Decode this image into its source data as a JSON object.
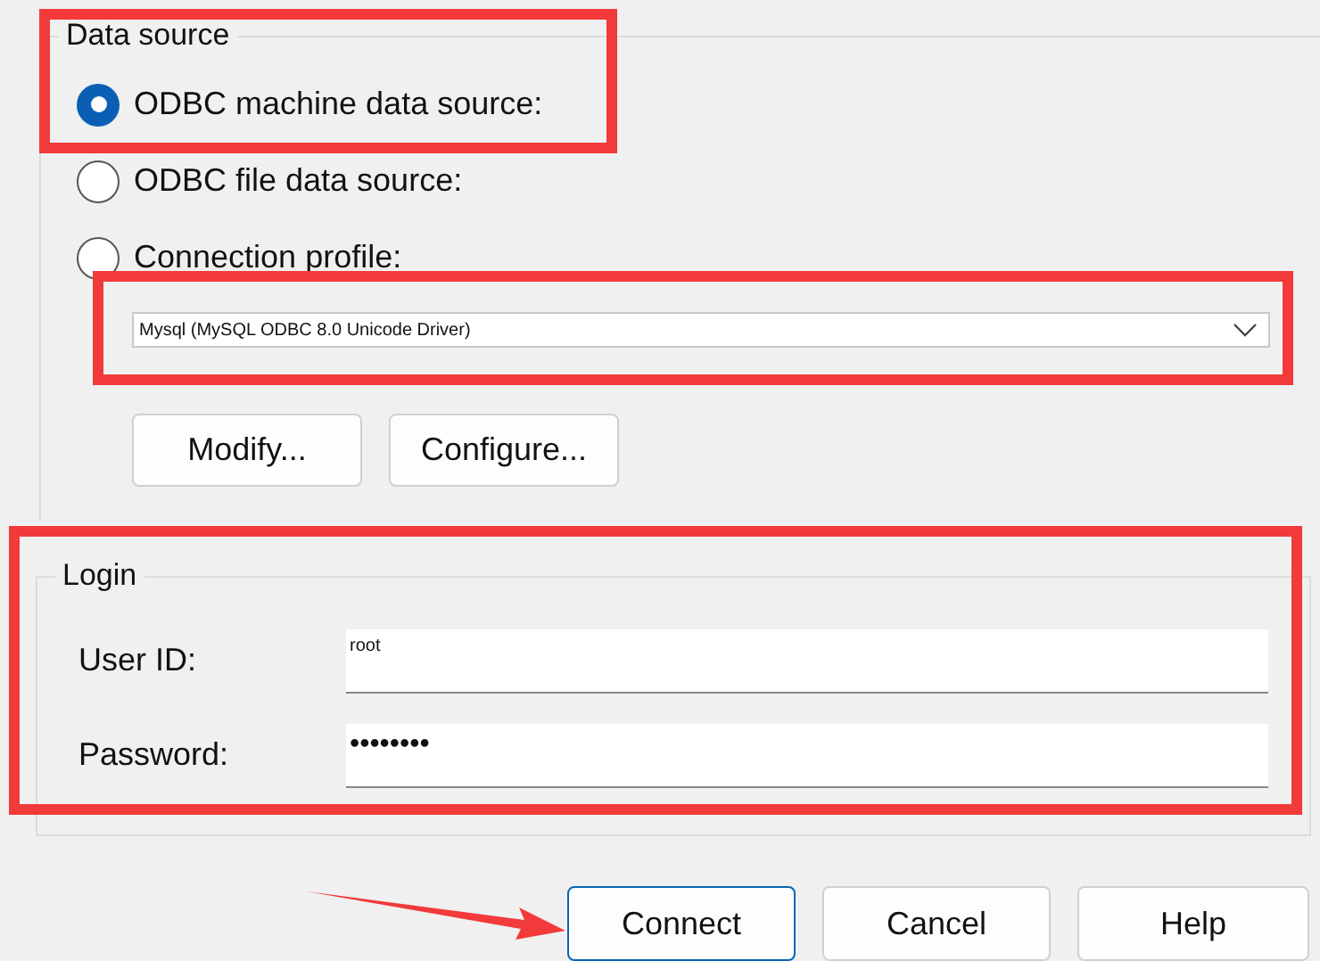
{
  "data_source": {
    "title": "Data source",
    "options": [
      {
        "label": "ODBC machine data source:",
        "selected": true
      },
      {
        "label": "ODBC file data source:",
        "selected": false
      },
      {
        "label": "Connection profile:",
        "selected": false
      }
    ]
  },
  "profile_dropdown": {
    "value": "Mysql (MySQL ODBC 8.0 Unicode Driver)"
  },
  "profile_buttons": [
    "Modify...",
    "Configure..."
  ],
  "login": {
    "title": "Login",
    "fields": [
      {
        "label": "User ID:",
        "value": "root"
      },
      {
        "label": "Password:",
        "value": "••••••••"
      }
    ]
  },
  "buttons": [
    {
      "label": "Connect",
      "default": true
    },
    {
      "label": "Cancel",
      "default": false
    },
    {
      "label": "Help",
      "default": false
    }
  ]
}
